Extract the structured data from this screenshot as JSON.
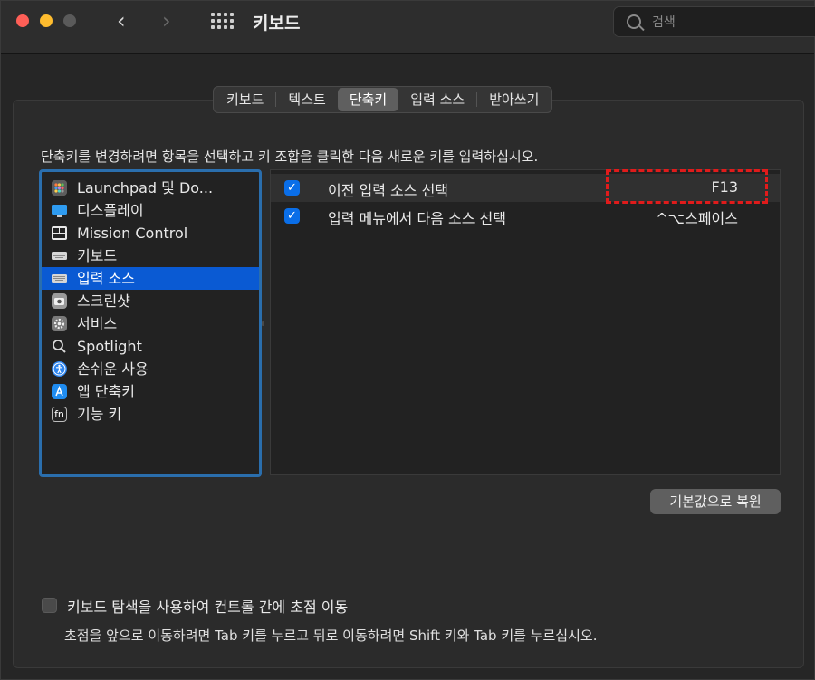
{
  "window": {
    "title": "키보드"
  },
  "search": {
    "placeholder": "검색"
  },
  "tabs": [
    {
      "label": "키보드",
      "active": false
    },
    {
      "label": "텍스트",
      "active": false
    },
    {
      "label": "단축키",
      "active": true
    },
    {
      "label": "입력 소스",
      "active": false
    },
    {
      "label": "받아쓰기",
      "active": false
    }
  ],
  "instructions": "단축키를 변경하려면 항목을 선택하고 키 조합을 클릭한 다음 새로운 키를 입력하십시오.",
  "categories": [
    {
      "label": "Launchpad 및 Do...",
      "icon": "launchpad-icon",
      "selected": false
    },
    {
      "label": "디스플레이",
      "icon": "display-icon",
      "selected": false
    },
    {
      "label": "Mission Control",
      "icon": "mission-control-icon",
      "selected": false
    },
    {
      "label": "키보드",
      "icon": "keyboard-icon",
      "selected": false
    },
    {
      "label": "입력 소스",
      "icon": "input-source-icon",
      "selected": true
    },
    {
      "label": "스크린샷",
      "icon": "screenshot-icon",
      "selected": false
    },
    {
      "label": "서비스",
      "icon": "services-gear-icon",
      "selected": false
    },
    {
      "label": "Spotlight",
      "icon": "spotlight-search-icon",
      "selected": false
    },
    {
      "label": "손쉬운 사용",
      "icon": "accessibility-icon",
      "selected": false
    },
    {
      "label": "앱 단축키",
      "icon": "app-shortcuts-icon",
      "selected": false
    },
    {
      "label": "기능 키",
      "icon": "fn-key-icon",
      "selected": false
    }
  ],
  "fn_icon_text": "fn",
  "shortcuts": [
    {
      "label": "이전 입력 소스 선택",
      "key": "F13",
      "checked": true
    },
    {
      "label": "입력 메뉴에서 다음 소스 선택",
      "key": "^⌥스페이스",
      "checked": true
    }
  ],
  "restore_button": "기본값으로 복원",
  "keyboard_navigation": {
    "label": "키보드 탐색을 사용하여 컨트롤 간에 초점 이동",
    "checked": false,
    "description": "초점을 앞으로 이동하려면 Tab 키를 누르고 뒤로 이동하려면 Shift 키와 Tab 키를 누르십시오."
  },
  "colors": {
    "accent": "#0a5ad3",
    "checkbox": "#0a6ee8",
    "highlight_dashed": "#e01b1b",
    "focus_ring": "#2a6ead"
  }
}
